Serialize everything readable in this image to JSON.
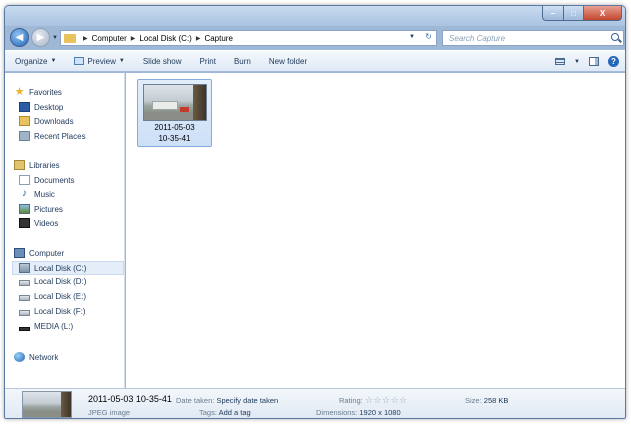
{
  "window": {
    "caption_min": "–",
    "caption_max": "□",
    "caption_close": "X"
  },
  "address_bar": {
    "crumbs": [
      "Computer",
      "Local Disk (C:)",
      "Capture"
    ]
  },
  "search": {
    "placeholder": "Search Capture"
  },
  "toolbar": {
    "items": [
      "Organize",
      "Preview",
      "Slide show",
      "Print",
      "Burn",
      "New folder"
    ]
  },
  "nav_pane": {
    "favorites": {
      "title": "Favorites",
      "items": [
        "Desktop",
        "Downloads",
        "Recent Places"
      ]
    },
    "libraries": {
      "title": "Libraries",
      "items": [
        "Documents",
        "Music",
        "Pictures",
        "Videos"
      ]
    },
    "computer": {
      "title": "Computer",
      "items": [
        "Local Disk (C:)",
        "Local Disk (D:)",
        "Local Disk (E:)",
        "Local Disk (F:)",
        "MEDIA (L:)"
      ]
    },
    "network": {
      "title": "Network"
    },
    "selected": "Local Disk (C:)"
  },
  "files": [
    {
      "name_line1": "2011-05-03",
      "name_line2": "10-35-41"
    }
  ],
  "details": {
    "name": "2011-05-03 10-35-41",
    "type": "JPEG image",
    "date_label": "Date taken:",
    "date_value": "Specify date taken",
    "tags_label": "Tags:",
    "tags_value": "Add a tag",
    "rating_label": "Rating:",
    "rating_stars": "☆☆☆☆☆",
    "dimensions_label": "Dimensions:",
    "dimensions_value": "1920 x 1080",
    "size_label": "Size:",
    "size_value": "258 KB"
  }
}
